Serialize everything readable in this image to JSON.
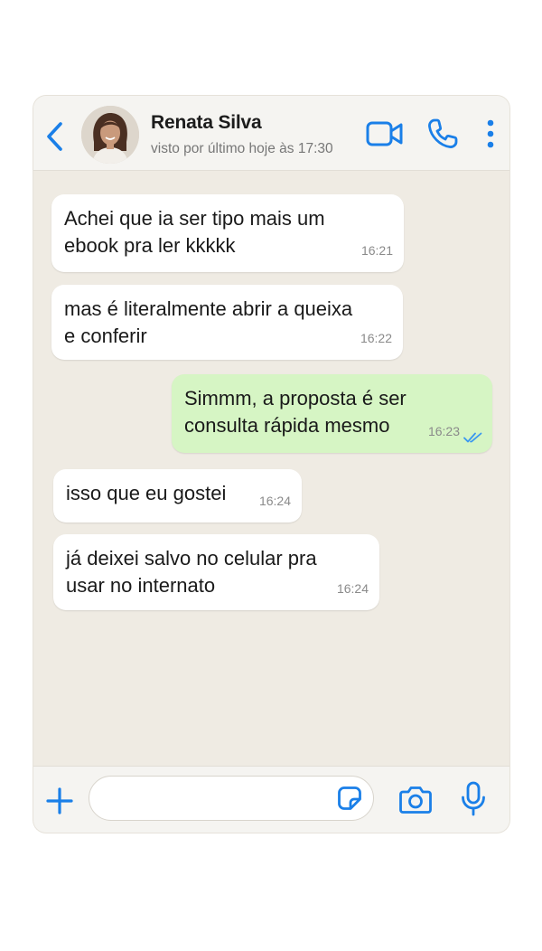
{
  "header": {
    "contact_name": "Renata Silva",
    "last_seen": "visto por último hoje às 17:30",
    "icons": [
      "back-chevron-icon",
      "video-call-icon",
      "phone-call-icon",
      "more-vertical-icon"
    ]
  },
  "messages": [
    {
      "direction": "incoming",
      "text": "Achei que ia ser tipo mais um\nebook pra ler kkkkk",
      "time": "16:21"
    },
    {
      "direction": "incoming",
      "text": "mas é literalmente abrir a queixa\ne conferir",
      "time": "16:22"
    },
    {
      "direction": "outgoing",
      "text": "Simmm, a proposta é ser\nconsulta rápida mesmo",
      "time": "16:23",
      "status": "read"
    },
    {
      "direction": "incoming",
      "text": "isso que eu gostei",
      "time": "16:24"
    },
    {
      "direction": "incoming",
      "text": "já deixei salvo no celular pra\nusar no internato",
      "time": "16:24"
    }
  ],
  "input_bar": {
    "placeholder": "",
    "icons": [
      "plus-icon",
      "sticker-icon",
      "camera-icon",
      "microphone-icon"
    ]
  },
  "colors": {
    "accent": "#1a7fe8",
    "chat_background": "#efebe3",
    "outgoing_bubble": "#d6f5c4",
    "incoming_bubble": "#ffffff",
    "read_ticks": "#3a97f0"
  }
}
